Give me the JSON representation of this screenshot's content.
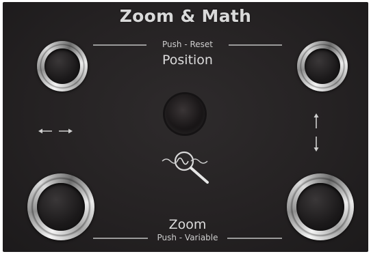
{
  "panel": {
    "title": "Zoom & Math",
    "position_section": {
      "hint": "Push - Reset",
      "label": "Position"
    },
    "zoom_section": {
      "label": "Zoom",
      "hint": "Push - Variable"
    },
    "icons": {
      "horizontal": "left-right-arrows-icon",
      "vertical": "up-down-arrows-icon",
      "math": "waveform-magnifier-icon"
    }
  }
}
